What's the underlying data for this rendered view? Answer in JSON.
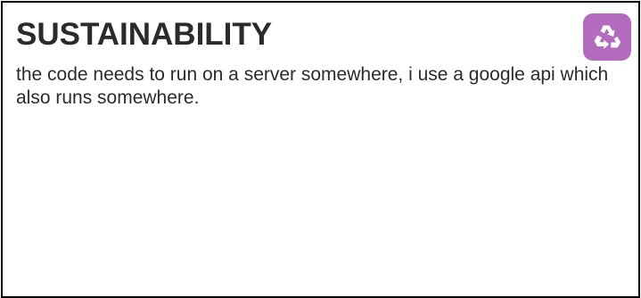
{
  "card": {
    "title": "SUSTAINABILITY",
    "body": "the code needs to run on a server somewhere, i use a google api which also runs somewhere.",
    "icon": {
      "name": "recycle-icon",
      "background": "#b36bbd",
      "foreground": "#ffffff"
    }
  },
  "colors": {
    "text": "#2b2b2b",
    "border": "#000000",
    "background": "#ffffff"
  }
}
